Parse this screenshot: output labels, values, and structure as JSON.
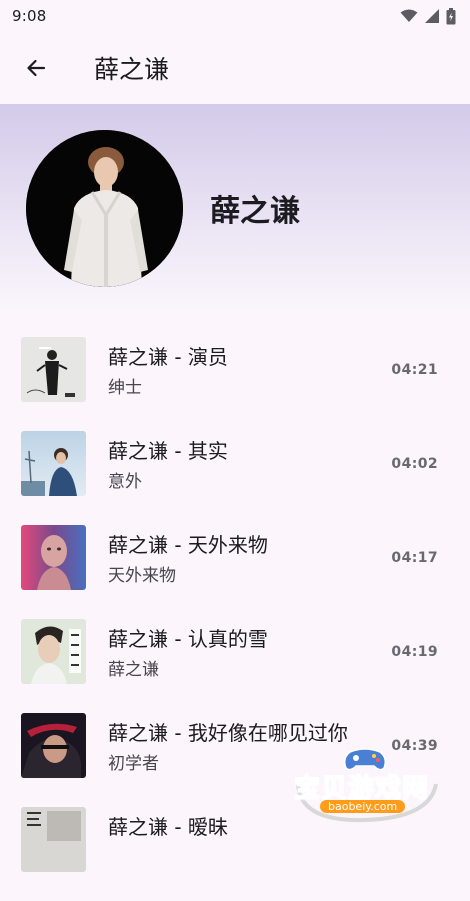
{
  "status_bar": {
    "time": "9:08",
    "icons": [
      "wifi-icon",
      "signal-icon",
      "battery-icon"
    ]
  },
  "app_bar": {
    "back_icon": "arrow-left-icon",
    "title": "薛之谦"
  },
  "hero": {
    "artist_name": "薛之谦"
  },
  "songs": [
    {
      "title": "薛之谦 - 演员",
      "album": "绅士",
      "duration": "04:21"
    },
    {
      "title": "薛之谦 - 其实",
      "album": "意外",
      "duration": "04:02"
    },
    {
      "title": "薛之谦 - 天外来物",
      "album": "天外来物",
      "duration": "04:17"
    },
    {
      "title": "薛之谦 - 认真的雪",
      "album": "薛之谦",
      "duration": "04:19"
    },
    {
      "title": "薛之谦 - 我好像在哪见过你",
      "album": "初学者",
      "duration": "04:39"
    },
    {
      "title": "薛之谦 - 暧昧",
      "album": "",
      "duration": ""
    }
  ],
  "watermark": {
    "text": "宝贝游戏网",
    "url": "baobeiy.com"
  },
  "colors": {
    "background": "#fcf5fc",
    "hero_gradient_top": "#d3cae9",
    "watermark_orange": "#ffb21c"
  }
}
